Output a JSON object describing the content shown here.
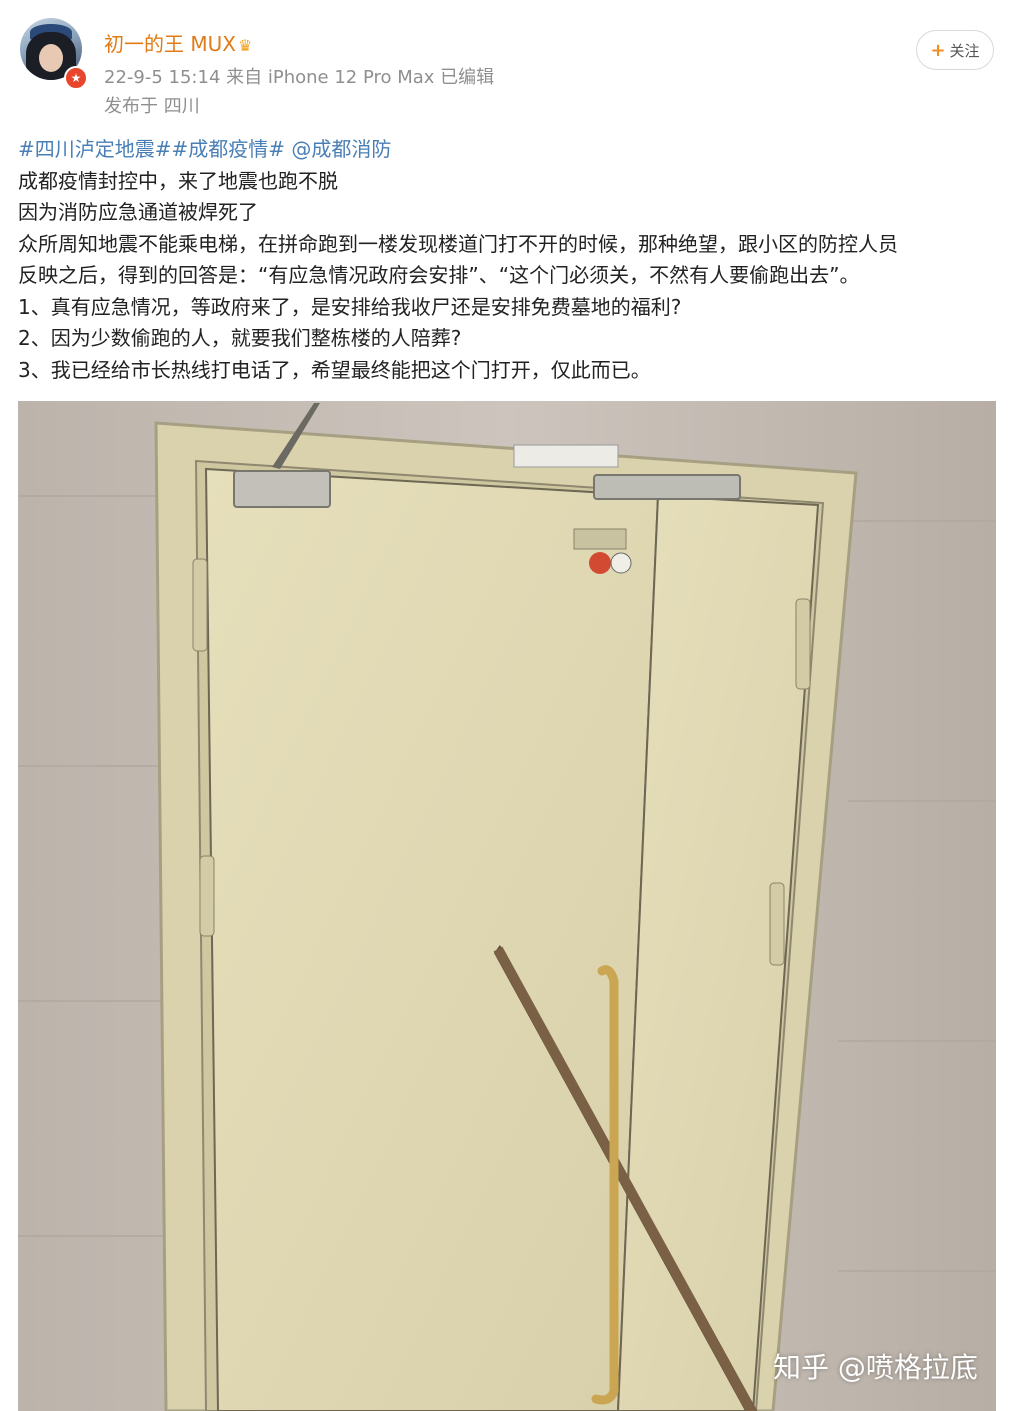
{
  "post": {
    "author": "初一的王 MUX",
    "meta": "22-9-5 15:14  来自 iPhone 12 Pro Max  已编辑",
    "location": "发布于 四川",
    "follow_label": "关注",
    "hashtags": "#四川泸定地震##成都疫情#",
    "mention": " @成都消防",
    "lines": [
      "成都疫情封控中，来了地震也跑不脱",
      "因为消防应急通道被焊死了",
      "众所周知地震不能乘电梯，在拼命跑到一楼发现楼道门打不开的时候，那种绝望，跟小区的防控人员",
      "反映之后，得到的回答是：“有应急情况政府会安排”、“这个门必须关，不然有人要偷跑出去”。",
      "1、真有应急情况，等政府来了，是安排给我收尸还是安排免费墓地的福利?",
      "2、因为少数偷跑的人，就要我们整栋楼的人陪葬?",
      "3、我已经给市长热线打电话了，希望最终能把这个门打开，仅此而已。"
    ]
  },
  "watermark": "知乎 @喷格拉底",
  "colors": {
    "author": "#e07b17",
    "hashtag": "#4a7fb5",
    "door": "#e3dcb4"
  }
}
